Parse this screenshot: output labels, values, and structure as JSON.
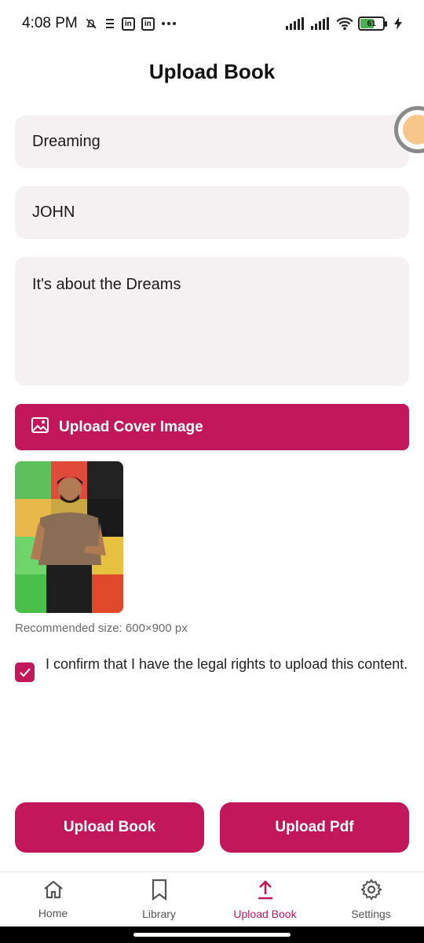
{
  "status_bar": {
    "time": "4:08 PM",
    "icons": [
      "mute-bell-icon",
      "sim-icon",
      "linkedin-icon",
      "linkedin-icon",
      "more-dots-icon"
    ],
    "battery_level": "61"
  },
  "header": {
    "title": "Upload Book"
  },
  "form": {
    "title_value": "Dreaming",
    "author_value": "JOHN",
    "description_value": "It's about the Dreams"
  },
  "cover": {
    "button_label": "Upload Cover Image",
    "recommended_size": "Recommended size: 600×900 px"
  },
  "consent": {
    "checked": true,
    "text": "I confirm that I have the legal rights to upload this content."
  },
  "actions": {
    "upload_book_label": "Upload Book",
    "upload_pdf_label": "Upload Pdf"
  },
  "bottom_nav": {
    "items": [
      {
        "label": "Home",
        "icon": "home-icon"
      },
      {
        "label": "Library",
        "icon": "bookmark-icon"
      },
      {
        "label": "Upload Book",
        "icon": "upload-icon",
        "active": true
      },
      {
        "label": "Settings",
        "icon": "gear-icon"
      }
    ]
  },
  "colors": {
    "accent": "#c2185b",
    "field_bg": "#f5f1f2"
  }
}
